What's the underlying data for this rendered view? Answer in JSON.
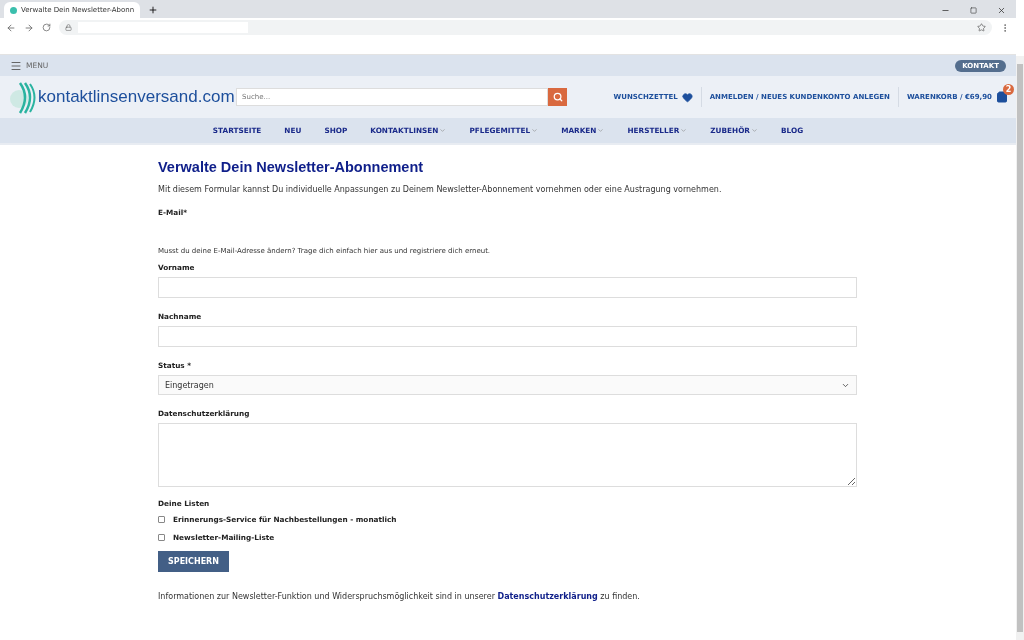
{
  "browser": {
    "tab_title": "Verwalte Dein Newsletter-Abonn"
  },
  "topbar": {
    "menu_label": "MENU",
    "contact_button": "KONTAKT"
  },
  "header": {
    "logo_text": "kontaktlinsenversand.com",
    "search": {
      "placeholder": "Suche..."
    },
    "wishlist": "WUNSCHZETTEL",
    "account": "ANMELDEN / NEUES KUNDENKONTO ANLEGEN",
    "cart": "WARENKORB / €69,90",
    "cart_count": "2"
  },
  "nav": [
    {
      "label": "STARTSEITE",
      "has_dropdown": false
    },
    {
      "label": "NEU",
      "has_dropdown": false
    },
    {
      "label": "SHOP",
      "has_dropdown": false
    },
    {
      "label": "KONTAKTLINSEN",
      "has_dropdown": true
    },
    {
      "label": "PFLEGEMITTEL",
      "has_dropdown": true
    },
    {
      "label": "MARKEN",
      "has_dropdown": true
    },
    {
      "label": "HERSTELLER",
      "has_dropdown": true
    },
    {
      "label": "ZUBEHÖR",
      "has_dropdown": true
    },
    {
      "label": "BLOG",
      "has_dropdown": false
    }
  ],
  "form": {
    "title": "Verwalte Dein Newsletter-Abonnement",
    "intro": "Mit diesem Formular kannst Du individuelle Anpassungen zu Deinem Newsletter-Abonnement vornehmen oder eine Austragung vornehmen.",
    "email_label": "E-Mail*",
    "email_hint": "Musst du deine E-Mail-Adresse ändern? Trage dich einfach hier aus und registriere dich erneut.",
    "fields": [
      {
        "kind": "input",
        "label": "Vorname"
      },
      {
        "kind": "input",
        "label": "Nachname"
      },
      {
        "kind": "select",
        "label": "Status *",
        "value": "Eingetragen"
      },
      {
        "kind": "textarea",
        "label": "Datenschutzerklärung"
      }
    ],
    "lists_label": "Deine Listen",
    "lists": [
      {
        "label": "Erinnerungs-Service für Nachbestellungen - monatlich",
        "checked": false
      },
      {
        "label": "Newsletter-Mailing-Liste",
        "checked": false
      }
    ],
    "save_button": "SPEICHERN",
    "footer_before": "Informationen zur Newsletter-Funktion und Widerspruchsmöglichkeit sind in unserer",
    "footer_link": "Datenschutzerklärung",
    "footer_after": "zu finden."
  }
}
